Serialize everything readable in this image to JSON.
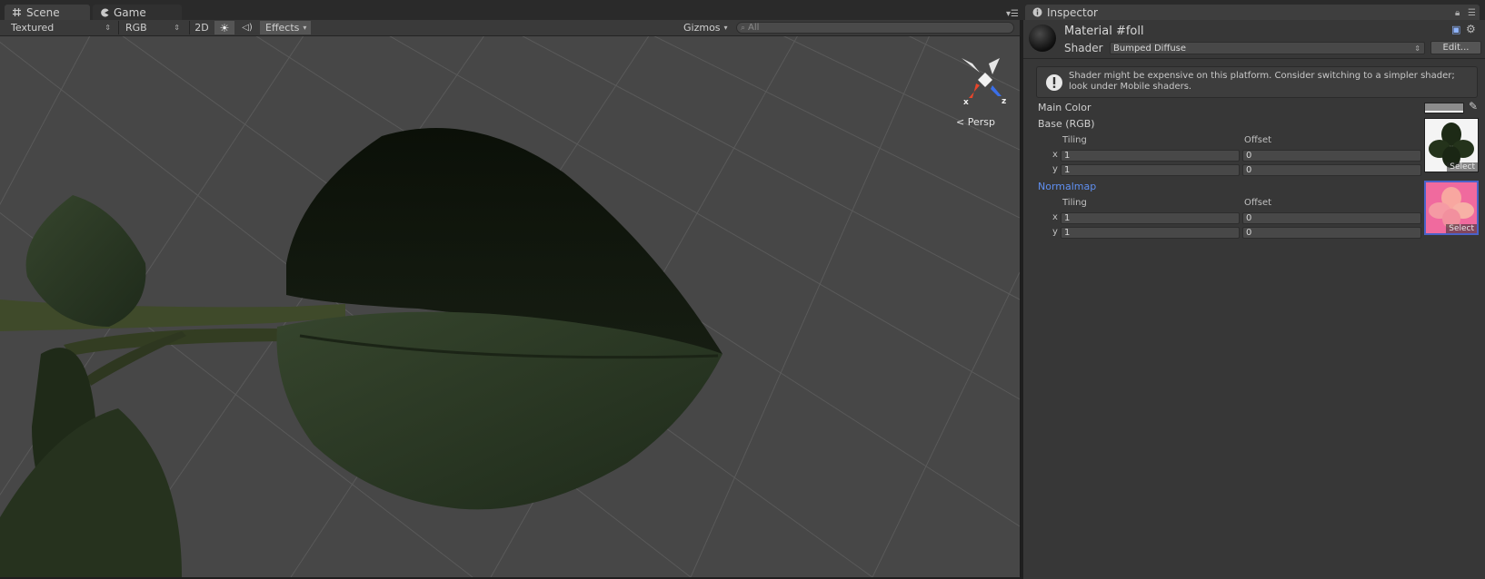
{
  "tabs": {
    "scene": "Scene",
    "game": "Game",
    "inspector": "Inspector"
  },
  "toolbar": {
    "draw_mode": "Textured",
    "render_mode": "RGB",
    "mode_2d": "2D",
    "effects": "Effects",
    "gizmos": "Gizmos",
    "search_placeholder": "All"
  },
  "scene_view": {
    "projection": "Persp",
    "axis_x": "x",
    "axis_z": "z"
  },
  "inspector": {
    "material_name": "Material #foll",
    "shader_label": "Shader",
    "shader_value": "Bumped Diffuse",
    "edit_button": "Edit...",
    "warning": "Shader might be expensive on this platform. Consider switching to a simpler shader; look under Mobile shaders.",
    "main_color_label": "Main Color",
    "textures": [
      {
        "label": "Base (RGB)",
        "tiling_label": "Tiling",
        "offset_label": "Offset",
        "x_label": "x",
        "y_label": "y",
        "tiling_x": "1",
        "tiling_y": "1",
        "offset_x": "0",
        "offset_y": "0",
        "select_label": "Select"
      },
      {
        "label": "Normalmap",
        "tiling_label": "Tiling",
        "offset_label": "Offset",
        "x_label": "x",
        "y_label": "y",
        "tiling_x": "1",
        "tiling_y": "1",
        "offset_x": "0",
        "offset_y": "0",
        "select_label": "Select"
      }
    ]
  },
  "colors": {
    "scene_bg": "#474747",
    "panel_bg": "#373737",
    "normalmap_label": "#5f8ff0",
    "axis_x": "#e8452a",
    "axis_z": "#3b6fe8"
  }
}
